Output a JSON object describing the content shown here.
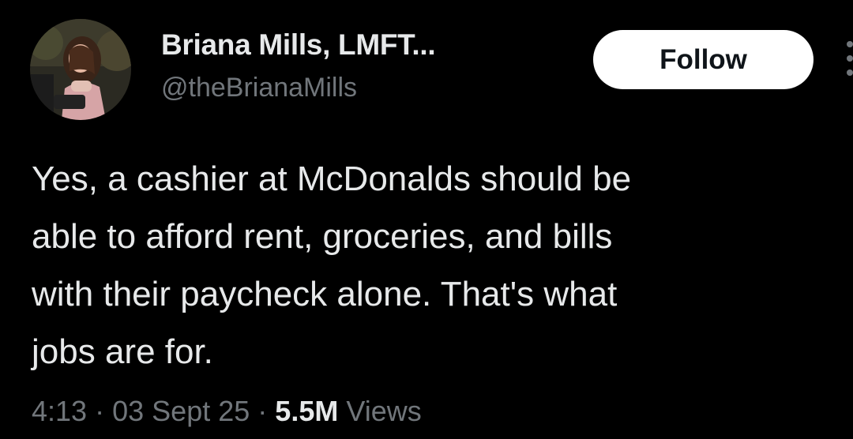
{
  "tweet": {
    "author": {
      "display_name": "Briana Mills, LMFT...",
      "handle": "@theBrianaMills"
    },
    "follow_label": "Follow",
    "text": "Yes, a cashier at McDonalds should be\nable to afford rent, groceries, and bills\nwith their paycheck alone. That's what\njobs are for.",
    "meta": {
      "time": "4:13",
      "separator": "·",
      "date": "03 Sept 25",
      "views_count": "5.5M",
      "views_label": "Views"
    }
  },
  "colors": {
    "background": "#000000",
    "primary_text": "#e7e9ea",
    "secondary_text": "#71767b",
    "follow_bg": "#ffffff",
    "follow_text": "#0f1419"
  },
  "icons": {
    "more": "more-vertical-icon"
  }
}
